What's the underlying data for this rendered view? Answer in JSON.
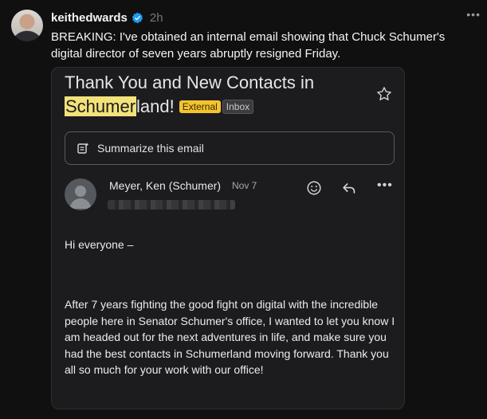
{
  "post": {
    "username": "keithedwards",
    "time": "2h",
    "text": "BREAKING: I've obtained an internal email showing that Chuck Schumer's digital director of seven years abruptly resigned Friday."
  },
  "email": {
    "subject_part1": "Thank You and New Contacts in ",
    "subject_highlight": "Schumer",
    "subject_part2": "land!",
    "badge_external": "External",
    "badge_inbox": "Inbox",
    "summarize_label": "Summarize this email",
    "sender_name": "Meyer, Ken (Schumer)",
    "date": "Nov 7",
    "greeting": "Hi everyone –",
    "body": "After 7 years fighting the good fight on digital with the incredible people here in Senator Schumer's office, I wanted to let you know I am headed out for the next adventures in life, and make sure you had the best contacts in Schumerland moving forward. Thank you all so much for your work with our office!"
  },
  "colors": {
    "verified": "#1d9bf0",
    "highlight": "#f3e27a",
    "external_badge": "#f4c430"
  },
  "icons": [
    "verified-icon",
    "more-icon",
    "star-icon",
    "summarize-icon",
    "emoji-icon",
    "reply-icon",
    "more-vert-icon"
  ]
}
